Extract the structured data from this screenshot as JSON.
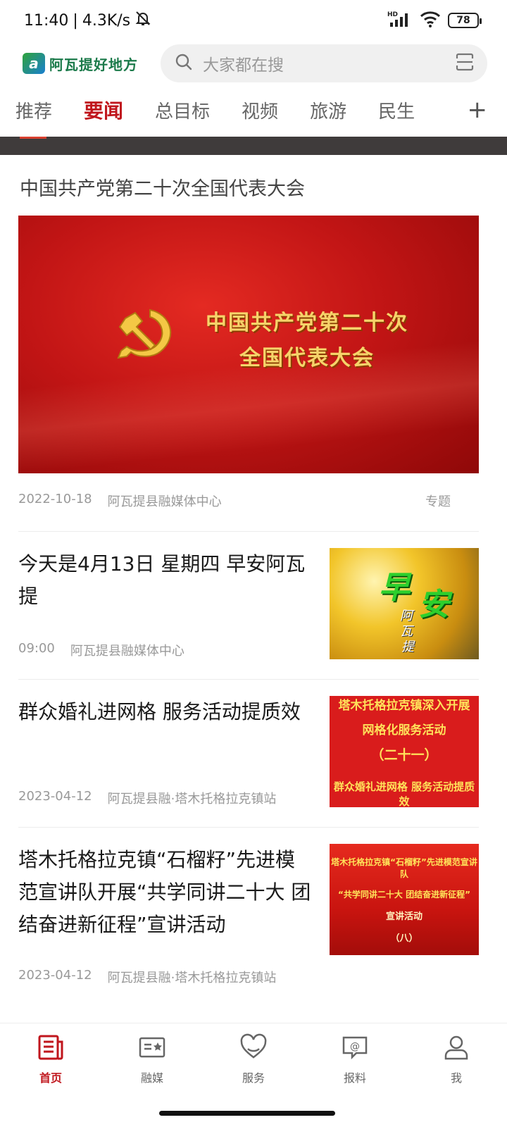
{
  "status_bar": {
    "time": "11:40",
    "separator": "|",
    "net_speed": "4.3K/s",
    "network": "HD",
    "battery": "78",
    "icons": [
      "mute-bell-icon",
      "signal-icon",
      "wifi-icon",
      "battery-icon"
    ]
  },
  "header": {
    "logo_text": "阿瓦提好地方",
    "search_placeholder": "大家都在搜",
    "icons": [
      "search-icon",
      "scan-icon"
    ]
  },
  "tabs": [
    "推荐",
    "要闻",
    "总目标",
    "视频",
    "旅游",
    "民生"
  ],
  "tabs_active_index": 1,
  "tab_add": "+",
  "feature": {
    "title": "中国共产党第二十次全国代表大会",
    "banner_line1": "中国共产党第二十次",
    "banner_line2": "全国代表大会",
    "date": "2022-10-18",
    "source": "阿瓦提县融媒体中心",
    "tag": "专题"
  },
  "news": [
    {
      "title": "今天是4月13日 星期四 早安阿瓦提",
      "time": "09:00",
      "source": "阿瓦提县融媒体中心",
      "thumb": {
        "big1": "早",
        "big2": "安",
        "small": [
          "阿",
          "瓦",
          "提"
        ]
      }
    },
    {
      "title": "群众婚礼进网格 服务活动提质效",
      "time": "2023-04-12",
      "source": "阿瓦提县融·塔木托格拉克镇站",
      "thumb": {
        "l1": "塔木托格拉克镇深入开展",
        "l2": "网格化服务活动",
        "l3": "（二十一）",
        "l4": "群众婚礼进网格 服务活动提质效"
      }
    },
    {
      "title": "塔木托格拉克镇“石榴籽”先进模范宣讲队开展“共学同讲二十大 团结奋进新征程”宣讲活动",
      "time": "2023-04-12",
      "source": "阿瓦提县融·塔木托格拉克镇站",
      "thumb": {
        "l1": "塔木托格拉克镇“石榴籽”先进模范宣讲队",
        "l2": "“共学同讲二十大 团结奋进新征程”",
        "l3": "宣讲活动",
        "l4": "（八）"
      }
    }
  ],
  "bottom_nav": [
    {
      "label": "首页",
      "icon": "news-icon",
      "active": true
    },
    {
      "label": "融媒",
      "icon": "media-icon",
      "active": false
    },
    {
      "label": "服务",
      "icon": "heart-service-icon",
      "active": false
    },
    {
      "label": "报料",
      "icon": "report-icon",
      "active": false
    },
    {
      "label": "我",
      "icon": "user-icon",
      "active": false
    }
  ],
  "colors": {
    "accent": "#c0161d",
    "muted": "#999999",
    "banner_red": "#c21515",
    "gold": "#f6d36a"
  }
}
